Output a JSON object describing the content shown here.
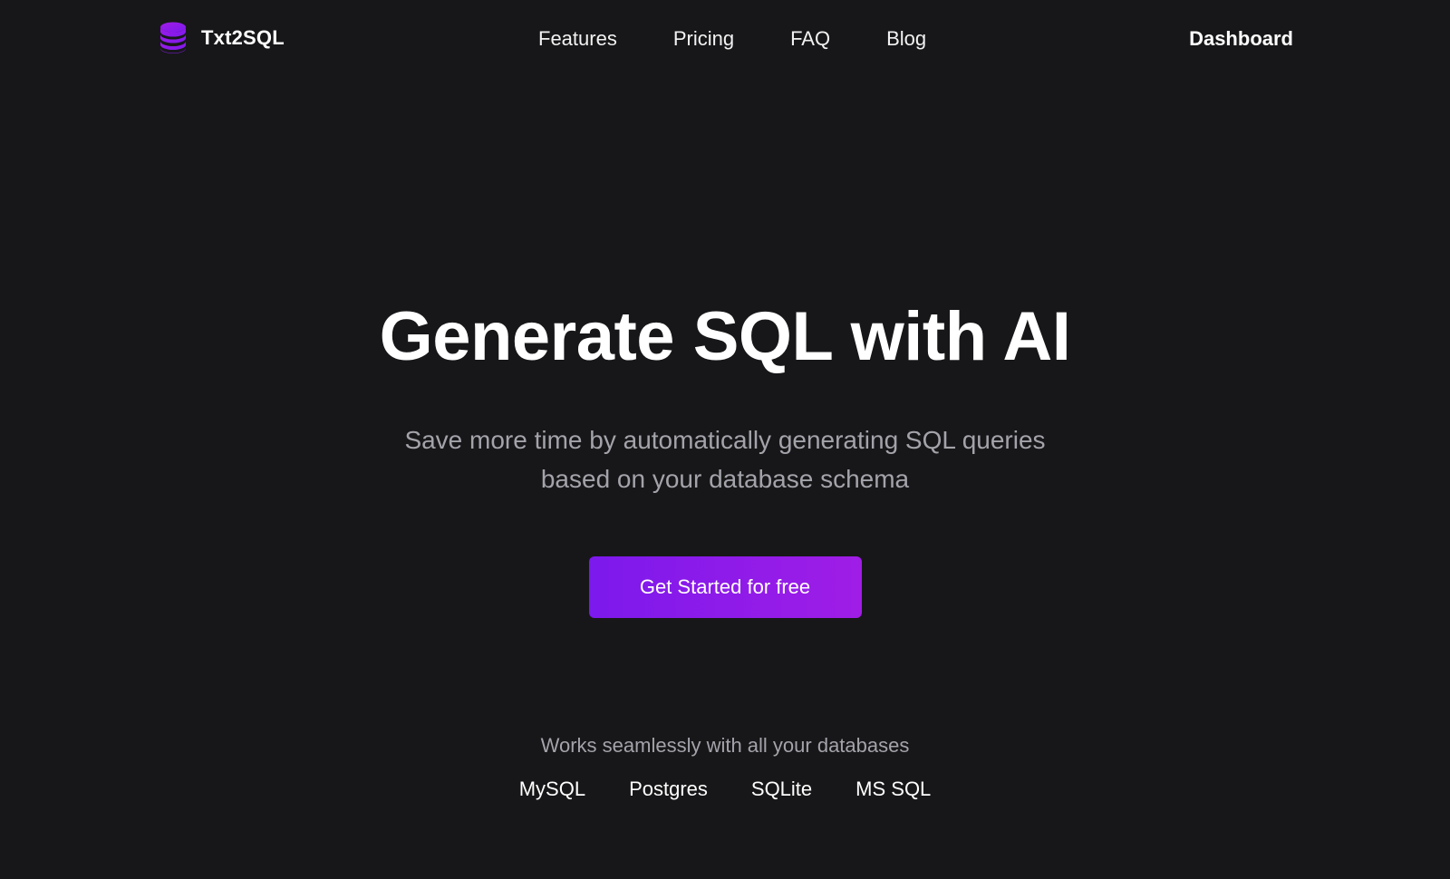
{
  "header": {
    "logo": {
      "icon": "database-icon",
      "text": "Txt2SQL"
    },
    "nav": [
      {
        "label": "Features"
      },
      {
        "label": "Pricing"
      },
      {
        "label": "FAQ"
      },
      {
        "label": "Blog"
      }
    ],
    "dashboard_label": "Dashboard"
  },
  "hero": {
    "title": "Generate SQL with AI",
    "subtitle": "Save more time by automatically generating SQL queries based on your database schema",
    "cta_label": "Get Started for free"
  },
  "databases": {
    "label": "Works seamlessly with all your databases",
    "items": [
      {
        "name": "MySQL"
      },
      {
        "name": "Postgres"
      },
      {
        "name": "SQLite"
      },
      {
        "name": "MS SQL"
      }
    ]
  },
  "colors": {
    "background": "#171719",
    "accent_start": "#7c19ec",
    "accent_end": "#a01de6",
    "muted_text": "#a3a3aa",
    "primary_text": "#ffffff"
  }
}
